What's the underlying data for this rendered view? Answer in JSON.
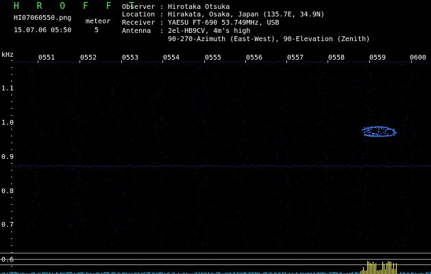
{
  "header": {
    "title": "H R O F F T",
    "filename": "HI07060550.png",
    "timestamp": "15.07.06 05:50",
    "meteor_label": "meteor",
    "meteor_count": "5"
  },
  "station": [
    {
      "key": "Observer ",
      "sep": ":",
      "value": "Hirotaka Otsuka"
    },
    {
      "key": "Location ",
      "sep": ":",
      "value": "Hirakata, Osaka, Japan (135.7E, 34.9N)"
    },
    {
      "key": "Receiver ",
      "sep": ":",
      "value": "YAESU FT-690 53.749MHz, USB"
    },
    {
      "key": "Antenna  ",
      "sep": ":",
      "value": "2el-HB9CV, 4m's high"
    },
    {
      "key": "",
      "sep": "",
      "value": "90-270-Azimuth (East-West), 90-Elevation (Zenith)"
    }
  ],
  "spectrogram": {
    "y_unit": "kHz",
    "time_ticks": [
      "0551",
      "0552",
      "0553",
      "0554",
      "0555",
      "0556",
      "0557",
      "0558",
      "0559",
      "0600"
    ],
    "freq_ticks": [
      "1.1",
      "1.0",
      "0.9",
      "0.8",
      "0.7",
      "0.6"
    ],
    "colors": {
      "background": "#000000",
      "noise": "#1a2a9a",
      "echo": "#3a7aff",
      "grid": "#bbbbbb",
      "level": "#ffff00",
      "baseline": "#00c8ff"
    }
  }
}
